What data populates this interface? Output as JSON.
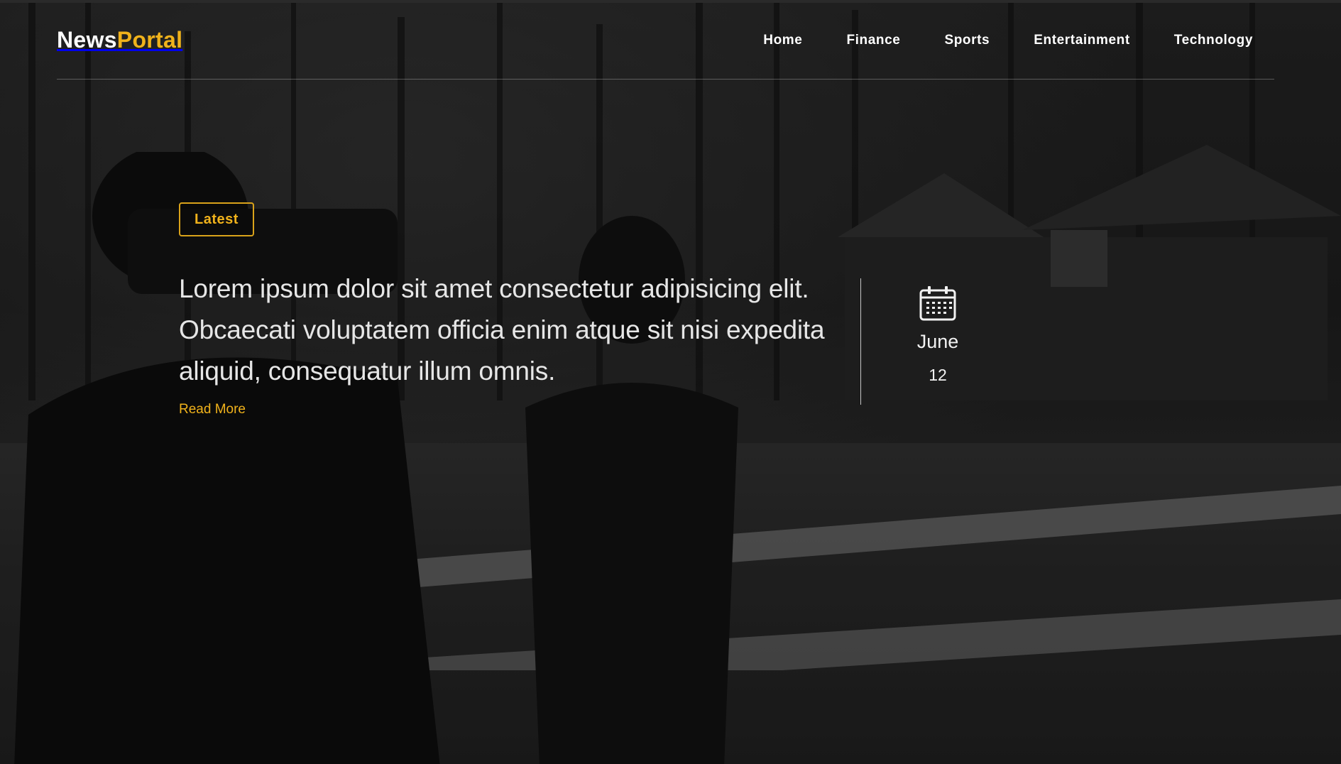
{
  "brand": {
    "part1": "News",
    "part2": "Portal"
  },
  "nav": [
    {
      "label": "Home"
    },
    {
      "label": "Finance"
    },
    {
      "label": "Sports"
    },
    {
      "label": "Entertainment"
    },
    {
      "label": "Technology"
    }
  ],
  "hero": {
    "badge": "Latest",
    "headline": "Lorem ipsum dolor sit amet consectetur adipisicing elit. Obcaecati voluptatem officia enim atque sit nisi expedita aliquid, consequatur illum omnis.",
    "read_more": "Read More",
    "date": {
      "month": "June",
      "day": "12",
      "icon": "calendar-icon"
    }
  },
  "colors": {
    "accent": "#f0b21b",
    "text": "#ffffff"
  }
}
